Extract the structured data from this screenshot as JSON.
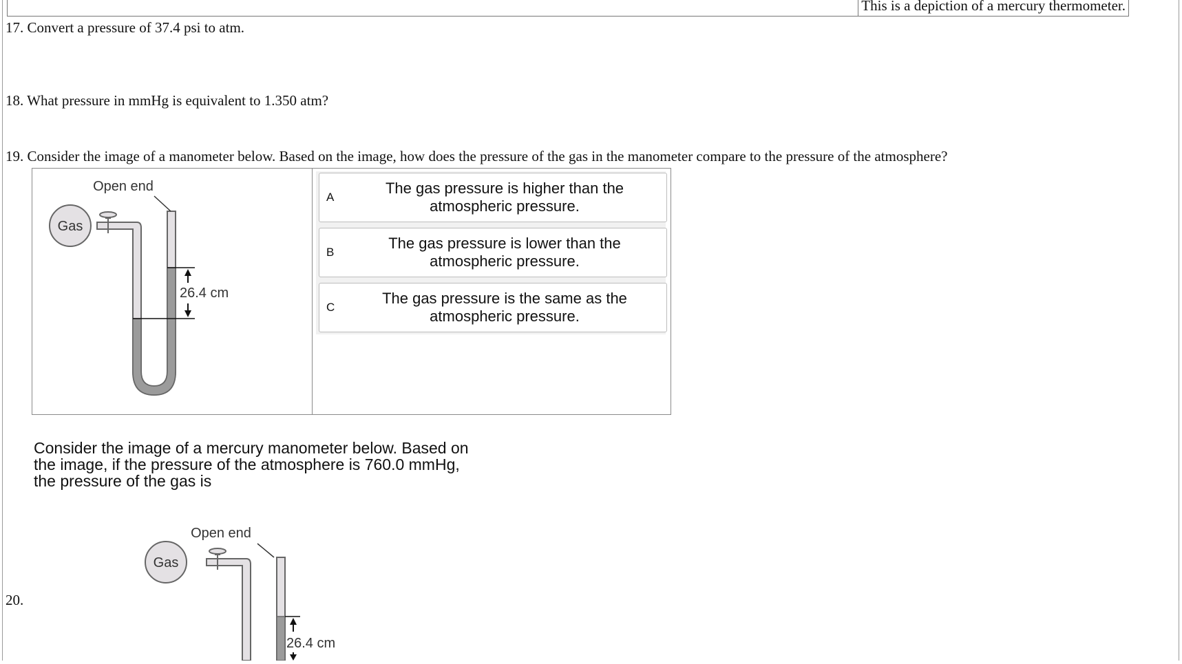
{
  "top_caption": "This is a depiction of a mercury thermometer.",
  "questions": {
    "q17": "17. Convert a pressure of 37.4 psi to atm.",
    "q18": "18. What pressure in mmHg is equivalent to 1.350 atm?",
    "q19": "19. Consider the image of a manometer below. Based on the image, how does the pressure of the gas in the manometer compare to the pressure of the atmosphere?",
    "q20_number": "20.",
    "q20_prompt": "Consider the image of a mercury manometer below. Based on the image, if the pressure of the atmosphere is 760.0 mmHg, the pressure of the gas is"
  },
  "manometer": {
    "open_end_label": "Open end",
    "gas_label": "Gas",
    "height_label": "26.4 cm"
  },
  "choices": [
    {
      "letter": "A",
      "text": "The gas pressure is higher than the atmospheric pressure."
    },
    {
      "letter": "B",
      "text": "The gas pressure is lower than the atmospheric pressure."
    },
    {
      "letter": "C",
      "text": "The gas pressure is the same as the atmospheric pressure."
    }
  ]
}
